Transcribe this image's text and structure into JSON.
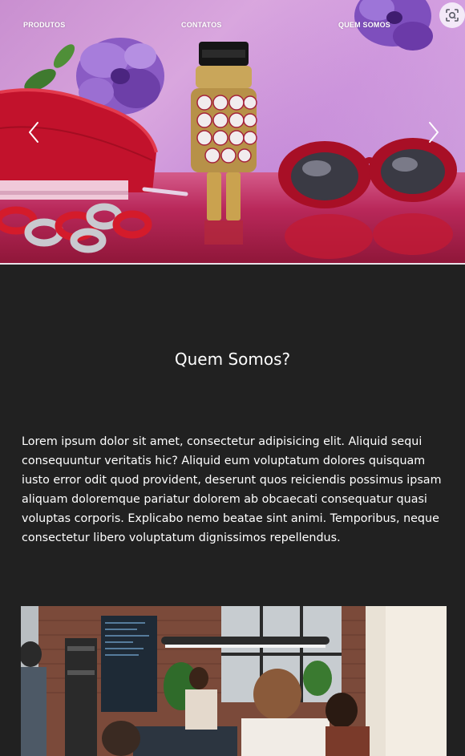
{
  "nav": {
    "items": [
      {
        "label": "PRODUTOS"
      },
      {
        "label": "CONTATOS"
      },
      {
        "label": "QUEM SOMOS"
      }
    ]
  },
  "hero": {
    "prev_icon": "chevron-left-icon",
    "next_icon": "chevron-right-icon",
    "lens_icon": "google-lens-icon"
  },
  "about": {
    "title": "Quem Somos?",
    "text": "Lorem ipsum dolor sit amet, consectetur adipisicing elit. Aliquid sequi consequuntur veritatis hic? Aliquid eum voluptatum dolores quisquam iusto error odit quod provident, deserunt quos reiciendis possimus ipsam aliquam doloremque pariatur dolorem ab obcaecati consequatur quasi voluptas corporis. Explicabo nemo beatae sint animi. Temporibus, neque consectetur libero voluptatum dignissimos repellendus."
  },
  "colors": {
    "background": "#212121",
    "text": "#ffffff",
    "hero_pink": "#d9a6de",
    "accent_red": "#c0102a"
  }
}
